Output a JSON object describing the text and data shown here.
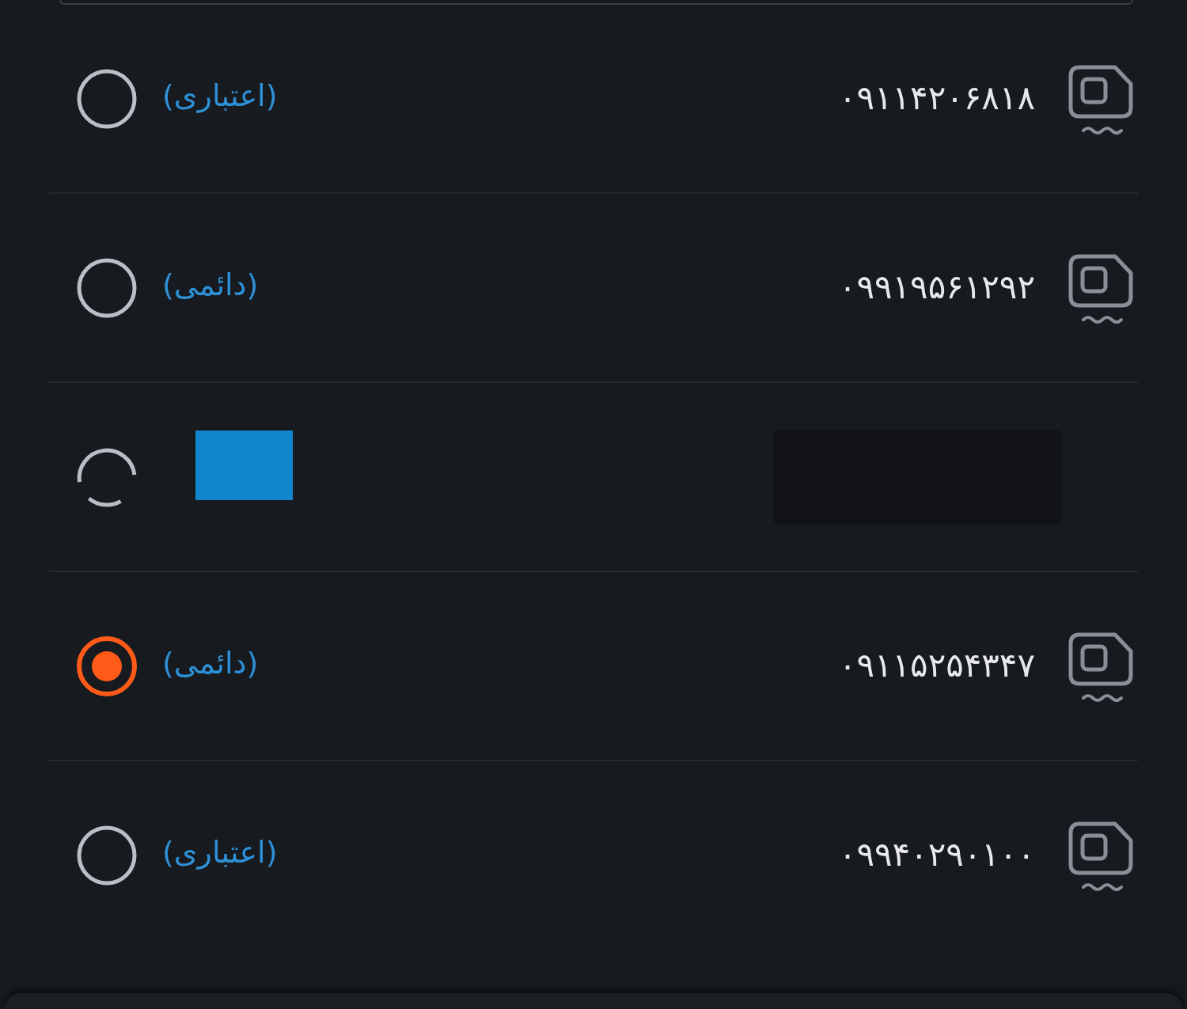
{
  "sim_list": [
    {
      "kind": "line",
      "number": "۰۹۱۱۴۲۰۶۸۱۸",
      "line_type": "(اعتباری)",
      "selected": false
    },
    {
      "kind": "line",
      "number": "۰۹۹۱۹۵۶۱۲۹۲",
      "line_type": "(دائمی)",
      "selected": false
    },
    {
      "kind": "redacted",
      "selected": false
    },
    {
      "kind": "line",
      "number": "۰۹۱۱۵۲۵۴۳۴۷",
      "line_type": "(دائمی)",
      "selected": true
    },
    {
      "kind": "line",
      "number": "۰۹۹۴۰۲۹۰۱۰۰",
      "line_type": "(اعتباری)",
      "selected": false
    }
  ]
}
